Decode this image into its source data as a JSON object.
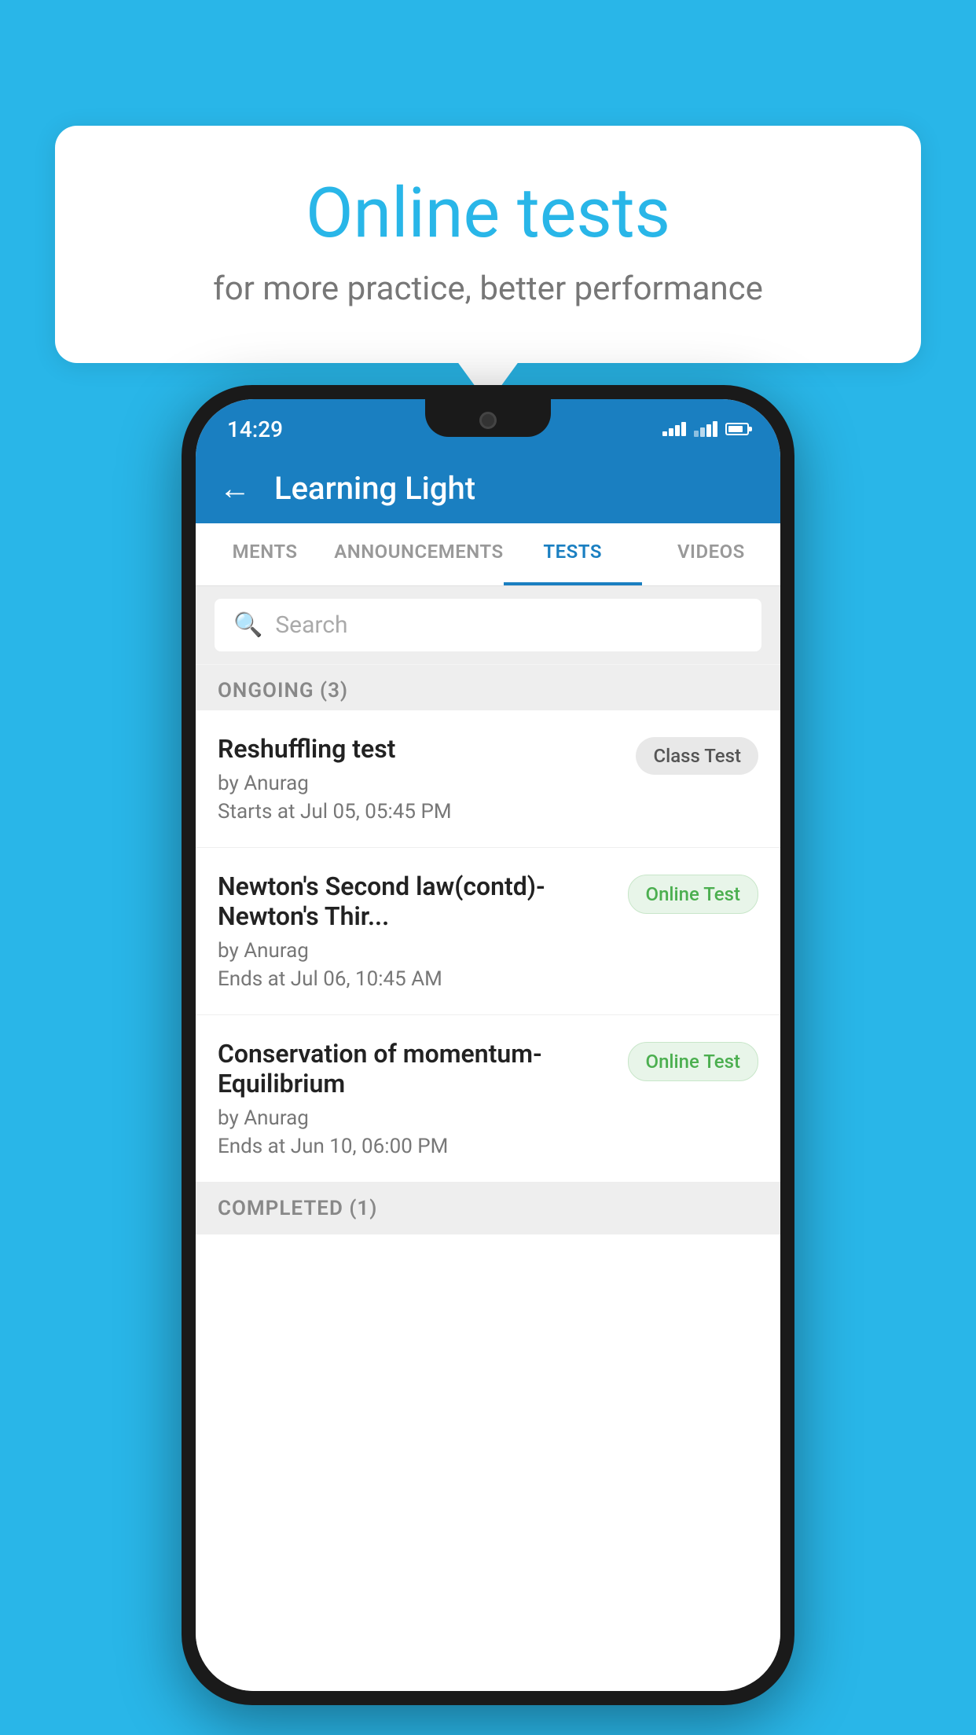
{
  "background_color": "#29b6e8",
  "bubble": {
    "title": "Online tests",
    "subtitle": "for more practice, better performance"
  },
  "phone": {
    "status_bar": {
      "time": "14:29"
    },
    "header": {
      "title": "Learning Light",
      "back_label": "←"
    },
    "tabs": [
      {
        "label": "MENTS",
        "active": false
      },
      {
        "label": "ANNOUNCEMENTS",
        "active": false
      },
      {
        "label": "TESTS",
        "active": true
      },
      {
        "label": "VIDEOS",
        "active": false
      }
    ],
    "search": {
      "placeholder": "Search"
    },
    "ongoing_section": {
      "label": "ONGOING (3)"
    },
    "tests": [
      {
        "name": "Reshuffling test",
        "author": "by Anurag",
        "time_label": "Starts at",
        "time_value": "Jul 05, 05:45 PM",
        "badge": "Class Test",
        "badge_type": "class"
      },
      {
        "name": "Newton's Second law(contd)-Newton's Thir...",
        "author": "by Anurag",
        "time_label": "Ends at",
        "time_value": "Jul 06, 10:45 AM",
        "badge": "Online Test",
        "badge_type": "online"
      },
      {
        "name": "Conservation of momentum-Equilibrium",
        "author": "by Anurag",
        "time_label": "Ends at",
        "time_value": "Jun 10, 06:00 PM",
        "badge": "Online Test",
        "badge_type": "online"
      }
    ],
    "completed_section": {
      "label": "COMPLETED (1)"
    }
  }
}
